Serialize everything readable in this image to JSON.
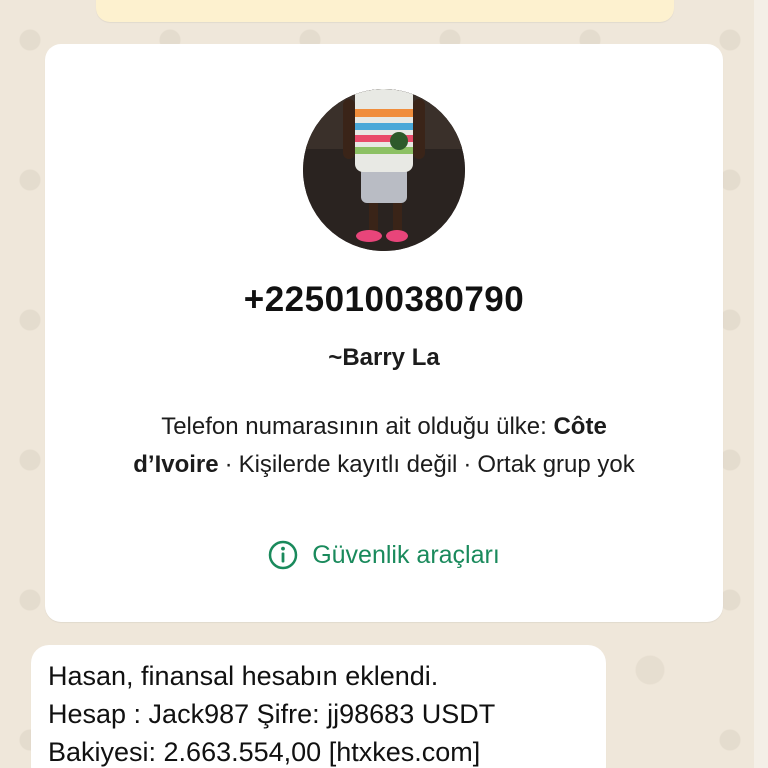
{
  "contact": {
    "phone": "+2250100380790",
    "push_name": "~Barry La",
    "info_prefix": "Telefon numarasının ait olduğu ülke: ",
    "country": "Côte d’Ivoire",
    "separator": "·",
    "not_in_contacts": "Kişilerde kayıtlı değil",
    "no_common_groups": "Ortak grup yok",
    "safety_tools_label": "Güvenlik araçları",
    "safety_icon": "info-circle-icon"
  },
  "message": {
    "text": "Hasan, finansal hesabın eklendi.\nHesap : Jack987 Şifre: jj98683 USDT\nBakiyesi: 2.663.554,00  [htxkes.com]"
  },
  "colors": {
    "background": "#efe7da",
    "card": "#ffffff",
    "accent_green": "#1a8a5c",
    "banner": "#fdf1cf"
  }
}
